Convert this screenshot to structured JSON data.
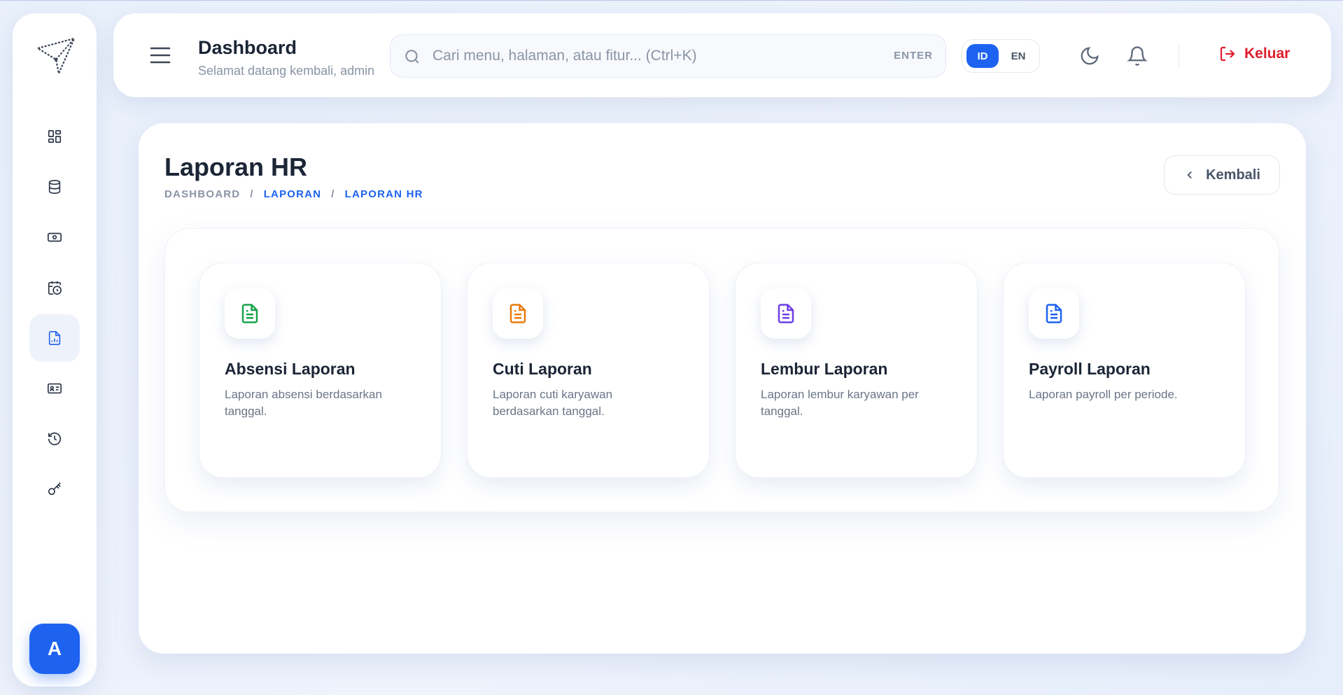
{
  "sidebar": {
    "items": [
      {
        "icon": "dashboard-grid-icon",
        "active": false
      },
      {
        "icon": "database-icon",
        "active": false
      },
      {
        "icon": "cash-icon",
        "active": false
      },
      {
        "icon": "calendar-clock-icon",
        "active": false
      },
      {
        "icon": "report-chart-icon",
        "active": true
      },
      {
        "icon": "id-card-icon",
        "active": false
      },
      {
        "icon": "history-icon",
        "active": false
      },
      {
        "icon": "key-icon",
        "active": false
      }
    ],
    "avatar_initial": "A"
  },
  "header": {
    "title": "Dashboard",
    "subtitle": "Selamat datang kembali, admin",
    "search_placeholder": "Cari menu, halaman, atau fitur... (Ctrl+K)",
    "search_hint": "ENTER",
    "lang_options": [
      "ID",
      "EN"
    ],
    "lang_selected": "ID",
    "logout_label": "Keluar"
  },
  "page": {
    "title": "Laporan HR",
    "breadcrumb": [
      "DASHBOARD",
      "LAPORAN",
      "LAPORAN HR"
    ],
    "breadcrumb_separator": "/",
    "back_label": "Kembali"
  },
  "cards": [
    {
      "title": "Absensi Laporan",
      "desc": "Laporan absensi berdasarkan tanggal.",
      "color": "#16a34a"
    },
    {
      "title": "Cuti Laporan",
      "desc": "Laporan cuti karyawan berdasarkan tanggal.",
      "color": "#ea7a0c"
    },
    {
      "title": "Lembur Laporan",
      "desc": "Laporan lembur karyawan per tanggal.",
      "color": "#6d3fe6"
    },
    {
      "title": "Payroll Laporan",
      "desc": "Laporan payroll per periode.",
      "color": "#1d63f0"
    }
  ],
  "colors": {
    "accent": "#1d63f0",
    "danger": "#e11d2e"
  }
}
